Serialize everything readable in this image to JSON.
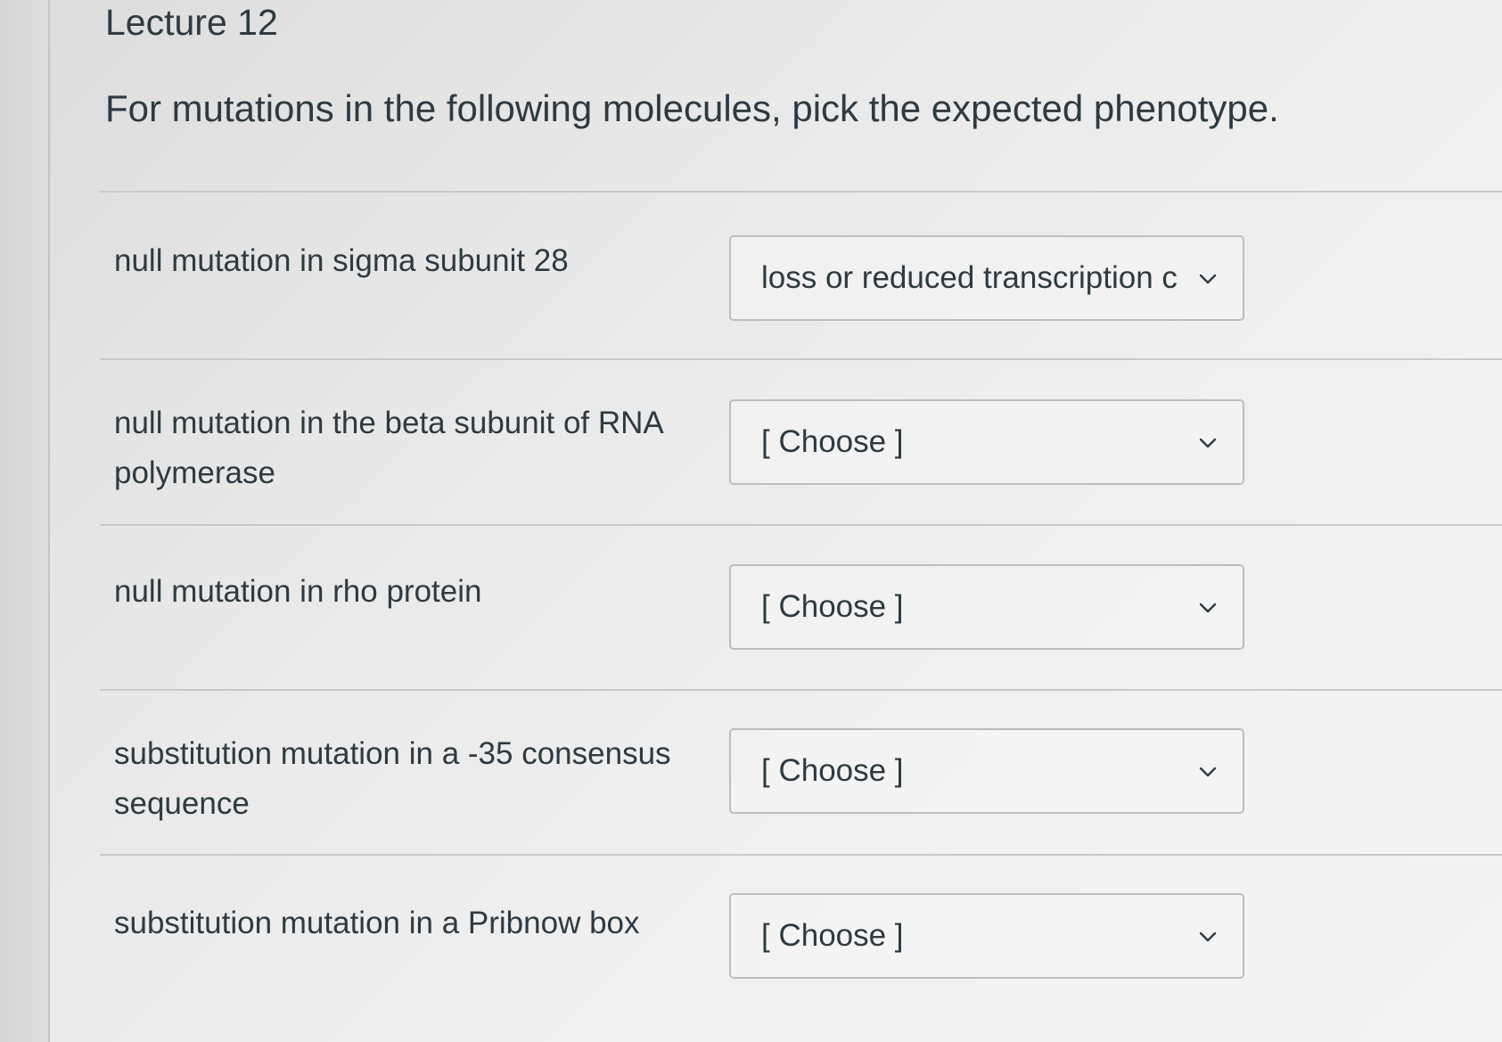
{
  "page": {
    "title": "Lecture 12",
    "prompt": "For mutations in the following molecules, pick the expected phenotype."
  },
  "rows": [
    {
      "label": "null mutation in sigma subunit 28",
      "selected": "loss or reduced transcription c",
      "icon": "chevron-down-icon"
    },
    {
      "label": "null mutation in the beta subunit of RNA polymerase",
      "selected": "[ Choose ]",
      "icon": "chevron-down-icon"
    },
    {
      "label": "null mutation in rho protein",
      "selected": "[ Choose ]",
      "icon": "chevron-down-icon"
    },
    {
      "label": "substitution mutation in a -35 consensus sequence",
      "selected": "[ Choose ]",
      "icon": "chevron-down-icon"
    },
    {
      "label": "substitution mutation in a Pribnow box",
      "selected": "[ Choose ]",
      "icon": "chevron-down-icon"
    }
  ],
  "colors": {
    "text": "#2f3a40",
    "border": "#bdbdbd",
    "divider": "#c9c9c9"
  }
}
